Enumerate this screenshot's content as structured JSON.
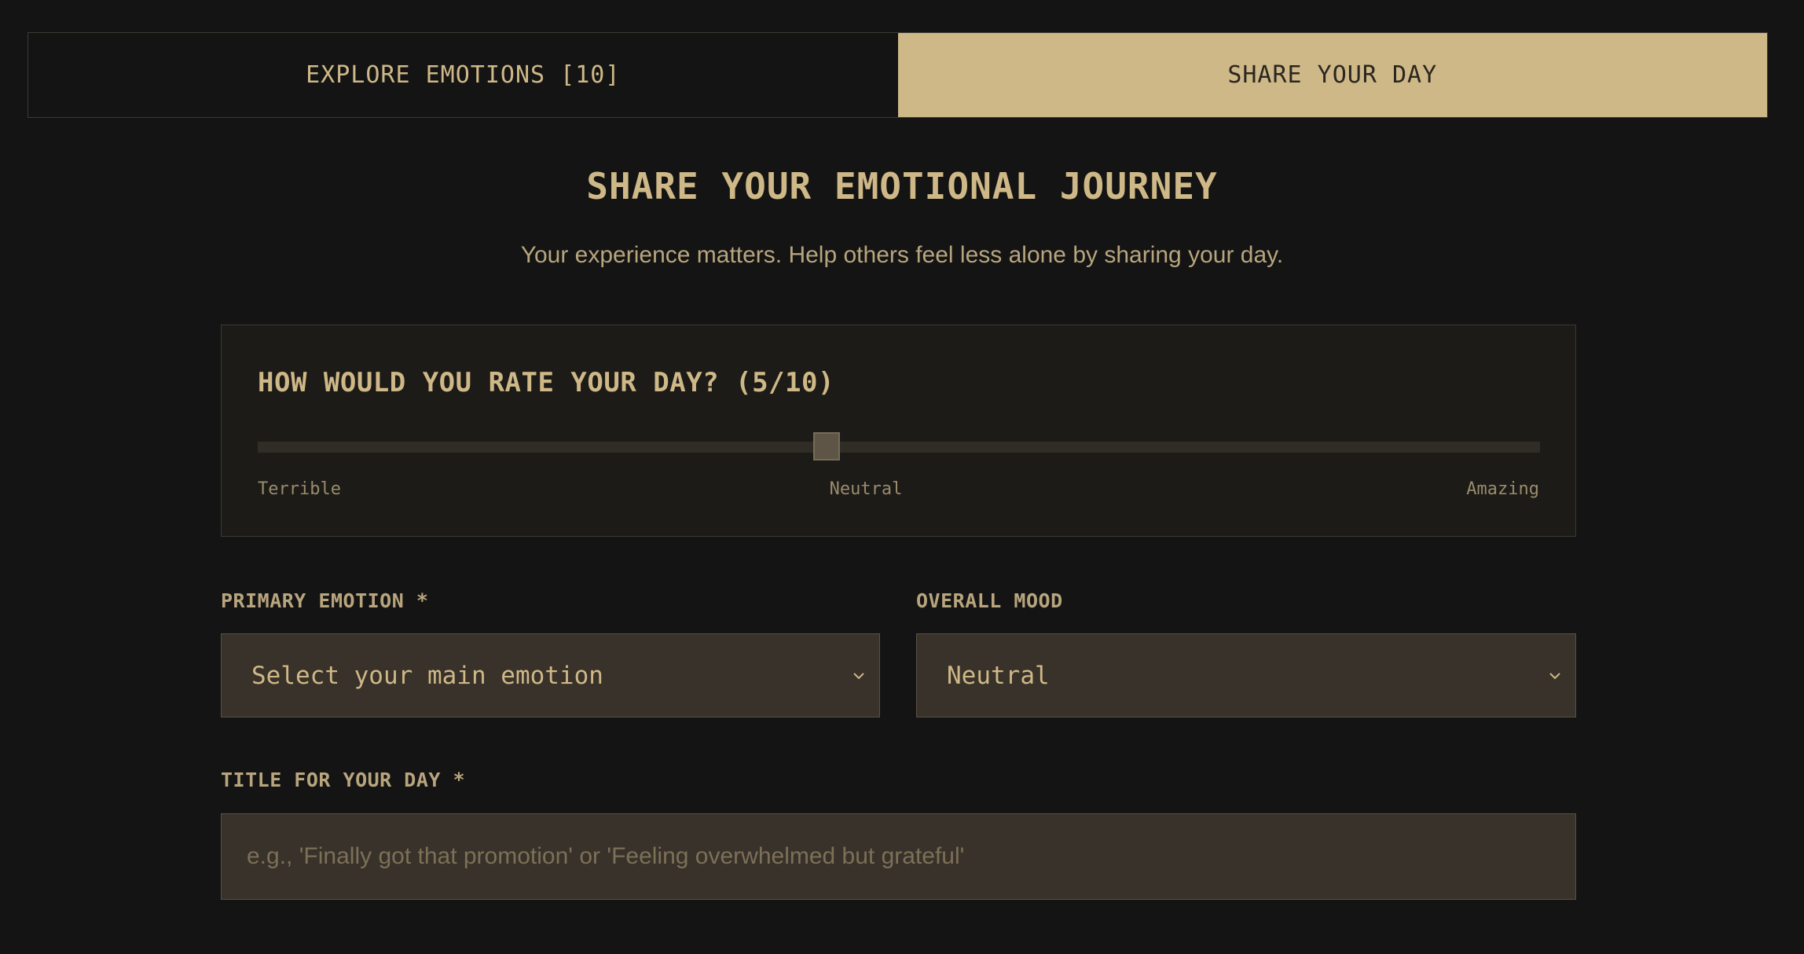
{
  "tabs": {
    "explore_label": "EXPLORE EMOTIONS [10]",
    "share_label": "SHARE YOUR DAY",
    "active": "share"
  },
  "page": {
    "title": "SHARE YOUR EMOTIONAL JOURNEY",
    "subtitle": "Your experience matters. Help others feel less alone by sharing your day."
  },
  "rating": {
    "title": "HOW WOULD YOU RATE YOUR DAY? (5/10)",
    "value": 5,
    "max": 10,
    "label_low": "Terrible",
    "label_mid": "Neutral",
    "label_high": "Amazing"
  },
  "primary_emotion": {
    "label": "PRIMARY EMOTION *",
    "value": "Select your main emotion"
  },
  "overall_mood": {
    "label": "OVERALL MOOD",
    "value": "Neutral"
  },
  "day_title": {
    "label": "TITLE FOR YOUR DAY *",
    "value": "",
    "placeholder": "e.g., 'Finally got that promotion' or 'Feeling overwhelmed but grateful'"
  },
  "colors": {
    "background": "#141414",
    "accent": "#cfb887",
    "input_bg": "#38322a"
  },
  "icons": {
    "select_chevron": "chevron-down-icon"
  }
}
